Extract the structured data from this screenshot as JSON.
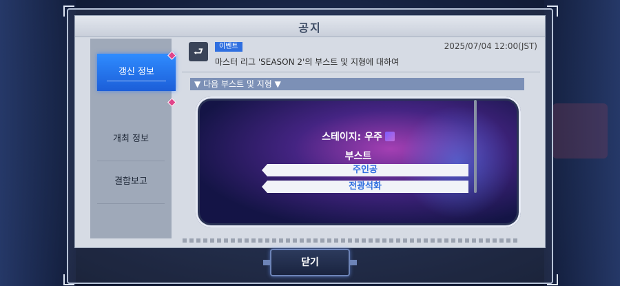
{
  "dialog": {
    "title": "공지",
    "close_label": "닫기"
  },
  "sidebar": {
    "items": [
      {
        "label": "갱신 정보",
        "active": true
      },
      {
        "label": "개최 정보",
        "active": false
      },
      {
        "label": "결함보고",
        "active": false
      }
    ]
  },
  "notice": {
    "badge": "이벤트",
    "date": "2025/07/04 12:00(JST)",
    "title": "마스터 리그 'SEASON 2'의 부스트 및 지형에 대하여",
    "section_heading": "▼ 다음 부스트 및 지형 ▼"
  },
  "banner": {
    "stage_label": "스테이지: 우주",
    "boost_label": "부스트",
    "boosts": [
      "주인공",
      "전광석화"
    ]
  },
  "colors": {
    "accent": "#2f6fe0",
    "sidebar_active": "#1c5ed8",
    "marker": "#e0448a"
  }
}
